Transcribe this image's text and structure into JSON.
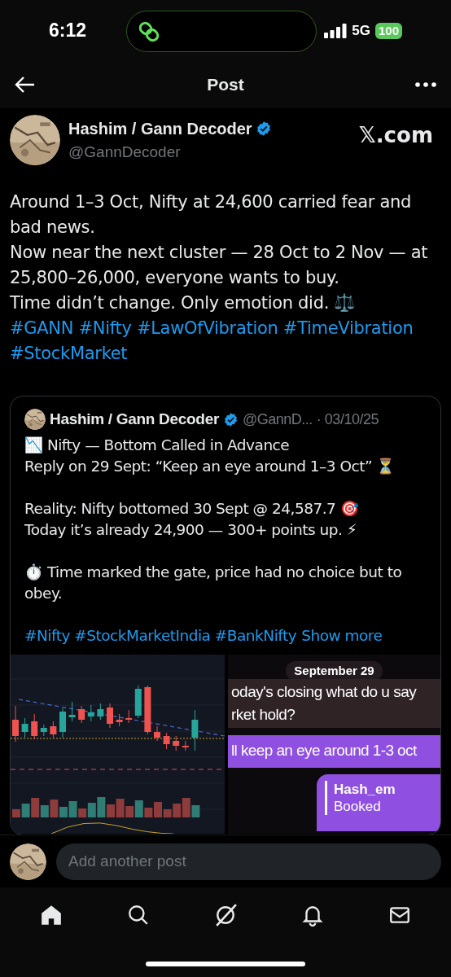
{
  "status_bar": {
    "time": "6:12",
    "network": "5G",
    "battery": "100"
  },
  "header": {
    "title": "Post"
  },
  "post": {
    "author": "Hashim / Gann Decoder",
    "verified": true,
    "handle": "@GannDecoder",
    "source": "𝕏.com",
    "paragraphs": [
      {
        "kind": "text",
        "text": "Around 1–3 Oct, Nifty at 24,600 carried fear and bad news."
      },
      {
        "kind": "text",
        "text": "Now near the next cluster — 28 Oct to 2 Nov — at 25,800–26,000, everyone wants to buy."
      },
      {
        "kind": "text",
        "text": "Time didn’t change. Only emotion did. ⚖️"
      },
      {
        "kind": "hashtags",
        "text": "#GANN #Nifty #LawOfVibration #TimeVibration #StockMarket"
      }
    ]
  },
  "quote": {
    "author": "Hashim / Gann Decoder",
    "verified": true,
    "handle": "@GannD...",
    "date": "· 03/10/25",
    "paragraphs": [
      {
        "kind": "text",
        "text": "📉 Nifty — Bottom Called in Advance"
      },
      {
        "kind": "text",
        "text": "Reply on 29 Sept: “Keep an eye around 1–3 Oct” ⏳"
      },
      {
        "kind": "gap"
      },
      {
        "kind": "text",
        "text": "Reality: Nifty bottomed 30 Sept @ 24,587.7 🎯"
      },
      {
        "kind": "text",
        "text": "Today it’s already 24,900 — 300+ points up. ⚡"
      },
      {
        "kind": "gap"
      },
      {
        "kind": "text",
        "text": "⏱️ Time marked the gate, price had no choice but to obey."
      },
      {
        "kind": "gap"
      },
      {
        "kind": "hashtags",
        "text": "#Nifty #StockMarketIndia #BankNifty",
        "more": "Show more"
      }
    ],
    "chat": {
      "date": "September 29",
      "received": [
        "oday's closing what do u say",
        "rket hold?"
      ],
      "sent": "ll keep an eye around 1-3 oct",
      "reply_name": "Hash_em",
      "reply_text": "Booked"
    }
  },
  "composer": {
    "placeholder": "Add another post"
  }
}
